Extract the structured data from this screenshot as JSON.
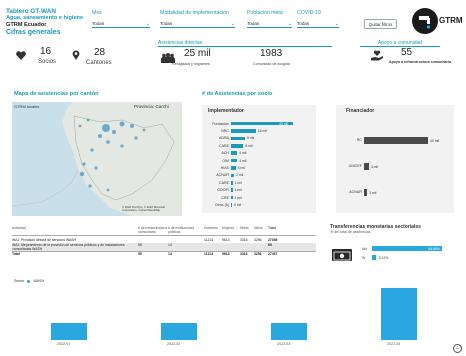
{
  "header": {
    "title1": "Tablero GT-WAN",
    "title2": "Agua, saneamiento e higiene",
    "title3": "GTRM Ecuador",
    "cifras": "Cifras generales"
  },
  "filters": [
    {
      "label": "Mes",
      "value": "Todas"
    },
    {
      "label": "Modalidad de implementación",
      "value": "Todas"
    },
    {
      "label": "Población meta",
      "value": "Todas"
    },
    {
      "label": "COVID-19",
      "value": "Todas"
    }
  ],
  "quitar_filtros": "Quitar filtros",
  "logo": {
    "text": "GTRM"
  },
  "kpis": {
    "socios_value": "16",
    "socios_label": "Socios",
    "cantones_value": "28",
    "cantones_label": "Cantones",
    "asistencias_title": "Asistencias directas",
    "personas_value": "25 mil",
    "personas_label": "Refugiados y migrantes",
    "comunidad_value": "1983",
    "comunidad_label": "Comunidad de acogida",
    "apoyo_title": "Apoyo a comunidad",
    "apoyo_value": "55",
    "apoyo_label": "Apoyo a infraestructura comunitaria"
  },
  "map": {
    "title": "Mapa de asistencias por cantón",
    "layer_label": "GTRM locales",
    "province_label": "Provincia: Carchi",
    "attribution": "© 2022 TomTom, © 2022 Microsoft Corporation, ©OpenStreetMap"
  },
  "socio_chart": {
    "title": "# de Asistencias por socio",
    "header": "Implementador",
    "rows": [
      {
        "name": "Fundación",
        "label": "40 mil",
        "value": 40
      },
      {
        "name": "NRC",
        "label": "16 mil",
        "value": 16
      },
      {
        "name": "ADRA",
        "label": "9 mil",
        "value": 9
      },
      {
        "name": "CARE",
        "label": "8 mil",
        "value": 8
      },
      {
        "name": "ACH",
        "label": "4 mil",
        "value": 4
      },
      {
        "name": "OIM",
        "label": "4 mil",
        "value": 4
      },
      {
        "name": "HIAS",
        "label": "3 mil",
        "value": 3
      },
      {
        "name": "ACNUR",
        "label": "2 mil",
        "value": 2
      },
      {
        "name": "CARE",
        "label": "1 mil",
        "value": 1
      },
      {
        "name": "COOPI",
        "label": "1 mil",
        "value": 1
      },
      {
        "name": "CRE",
        "label": "1 mil",
        "value": 1
      },
      {
        "name": "Otros (5)",
        "label": "0 mil",
        "value": 0.4
      }
    ]
  },
  "financiador_chart": {
    "header": "Financiador",
    "rows": [
      {
        "name": "RC",
        "label": "40 mil",
        "value": 40
      },
      {
        "name": "UNICEF",
        "label": "3 mil",
        "value": 3
      },
      {
        "name": "ACNUR",
        "label": "2 mil",
        "value": 2
      }
    ]
  },
  "table": {
    "headers": [
      "Actividad",
      "# de infraestructura comunitaria",
      "# de instituciones públicas",
      "Hombres",
      "Mujeres",
      "Niñas",
      "Niños",
      "Total"
    ],
    "rows": [
      [
        "WA1: Provisión directa de servicios WASH",
        "",
        "",
        "11213",
        "9613",
        "3316",
        "3256",
        "27398"
      ],
      [
        "WA2: Mejoramiento de la provisión de servicios públicos y de instalaciones comunitarias WASH",
        "55",
        "14",
        "",
        "",
        "",
        "",
        "69"
      ],
      [
        "Total",
        "55",
        "14",
        "11213",
        "9613",
        "3316",
        "3256",
        "27467"
      ]
    ]
  },
  "transfer": {
    "title": "Transferencias monetarias sectoriales",
    "subtitle": "% del total de asistencias",
    "rows": [
      {
        "name": "No",
        "label": "94,88%",
        "value": 94.88
      },
      {
        "name": "Sí",
        "label": "5,12%",
        "value": 5.12
      }
    ]
  },
  "sector": {
    "title": "Sector",
    "legend": "WASH",
    "color": "#29a8e0"
  },
  "chart_data": {
    "type": "bar",
    "categories": [
      "2022-01",
      "2022-02",
      "2022-03",
      "2022-04"
    ],
    "series": [
      {
        "name": "WASH",
        "values": [
          3,
          3,
          3,
          9
        ]
      }
    ],
    "xlabel": "",
    "ylabel": ""
  }
}
